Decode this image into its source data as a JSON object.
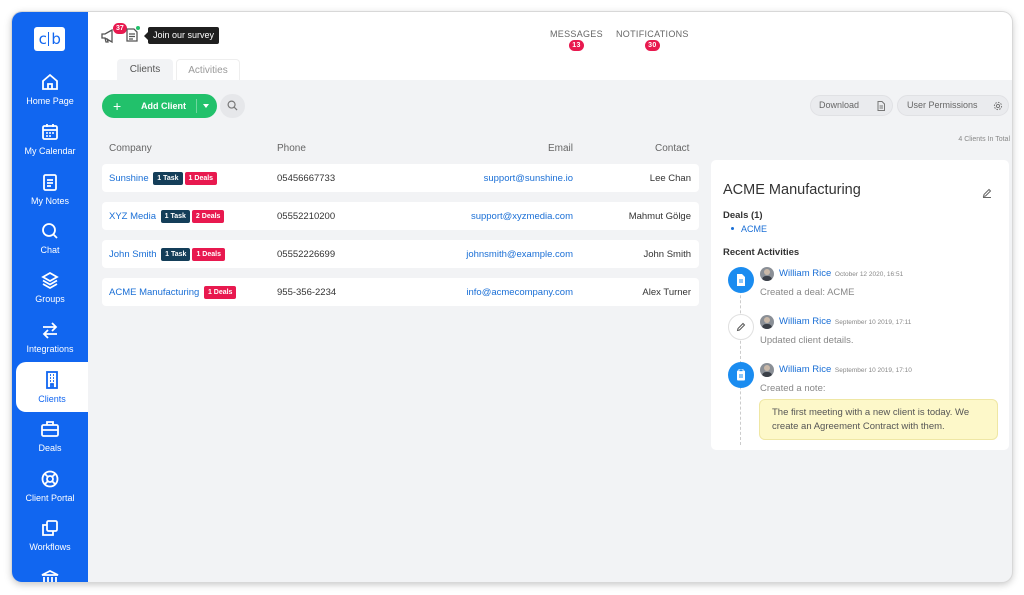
{
  "app": {
    "logo": "cb"
  },
  "sidebar": {
    "items": [
      {
        "label": "Home Page",
        "icon": "home-icon"
      },
      {
        "label": "My Calendar",
        "icon": "calendar-icon"
      },
      {
        "label": "My Notes",
        "icon": "notes-icon"
      },
      {
        "label": "Chat",
        "icon": "chat-icon"
      },
      {
        "label": "Groups",
        "icon": "layers-icon"
      },
      {
        "label": "Integrations",
        "icon": "arrows-icon"
      },
      {
        "label": "Clients",
        "icon": "building-icon",
        "active": true
      },
      {
        "label": "Deals",
        "icon": "briefcase-icon"
      },
      {
        "label": "Client Portal",
        "icon": "lifebuoy-icon"
      },
      {
        "label": "Workflows",
        "icon": "copy-icon"
      }
    ]
  },
  "topbar": {
    "announcement_badge": "37",
    "survey_tooltip": "Join our survey",
    "messages": {
      "label": "MESSAGES",
      "count": "13"
    },
    "notifications": {
      "label": "NOTIFICATIONS",
      "count": "30"
    },
    "tabs": [
      {
        "label": "Clients",
        "active": true
      },
      {
        "label": "Activities"
      }
    ]
  },
  "toolbar": {
    "add_client_label": "Add Client",
    "download_label": "Download",
    "user_permissions_label": "User Permissions",
    "total_count": "4 Clients In Total"
  },
  "table": {
    "headers": {
      "company": "Company",
      "phone": "Phone",
      "email": "Email",
      "contact": "Contact"
    },
    "rows": [
      {
        "company": "Sunshine",
        "tags": [
          "1 Task",
          "1 Deals"
        ],
        "phone": "05456667733",
        "email": "support@sunshine.io",
        "contact": "Lee Chan"
      },
      {
        "company": "XYZ Media",
        "tags": [
          "1 Task",
          "2 Deals"
        ],
        "phone": "05552210200",
        "email": "support@xyzmedia.com",
        "contact": "Mahmut Gölge"
      },
      {
        "company": "John Smith",
        "tags": [
          "1 Task",
          "1 Deals"
        ],
        "phone": "05552226699",
        "email": "johnsmith@example.com",
        "contact": "John Smith"
      },
      {
        "company": "ACME Manufacturing",
        "tags": [
          "1 Deals"
        ],
        "phone": "955-356-2234",
        "email": "info@acmecompany.com",
        "contact": "Alex Turner"
      }
    ]
  },
  "panel": {
    "title": "ACME Manufacturing",
    "deals_heading": "Deals (1)",
    "deal_item": "ACME",
    "activities_heading": "Recent Activities",
    "activities": [
      {
        "user": "William Rice",
        "date": "October 12 2020, 16:51",
        "desc": "Created a deal: ACME",
        "icon": "document-icon"
      },
      {
        "user": "William Rice",
        "date": "September 10 2019, 17:11",
        "desc": "Updated client details.",
        "icon": "pencil-icon"
      },
      {
        "user": "William Rice",
        "date": "September 10 2019, 17:10",
        "desc": "Created a note:",
        "icon": "clipboard-icon"
      }
    ],
    "note": "The first meeting with a new client is today. We create an Agreement Contract with them."
  },
  "colors": {
    "brand": "#1166f0",
    "add_button": "#22c16b",
    "deal_badge": "#e8194f",
    "task_badge": "#143e59",
    "note_bg": "#fdf8c9"
  }
}
